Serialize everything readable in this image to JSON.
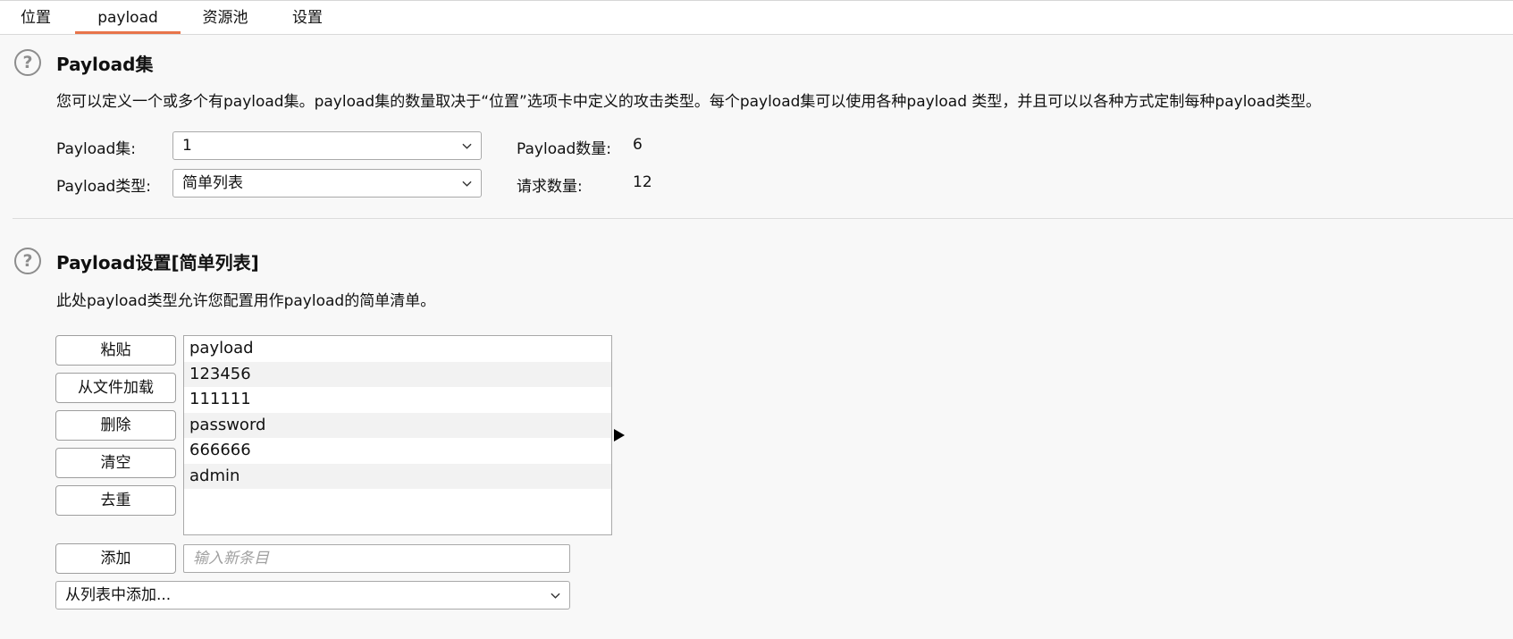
{
  "tabs": [
    {
      "label": "位置",
      "active": false
    },
    {
      "label": "payload",
      "active": true
    },
    {
      "label": "资源池",
      "active": false
    },
    {
      "label": "设置",
      "active": false
    }
  ],
  "payload_sets": {
    "help_icon": "question-circle-icon",
    "title": "Payload集",
    "description": "您可以定义一个或多个有payload集。payload集的数量取决于“位置”选项卡中定义的攻击类型。每个payload集可以使用各种payload 类型，并且可以以各种方式定制每种payload类型。",
    "set_label": "Payload集:",
    "set_value": "1",
    "type_label": "Payload类型:",
    "type_value": "简单列表",
    "count_label": "Payload数量:",
    "count_value": "6",
    "request_label": "请求数量:",
    "request_value": "12"
  },
  "payload_options": {
    "help_icon": "question-circle-icon",
    "title": "Payload设置[简单列表]",
    "description": "此处payload类型允许您配置用作payload的简单清单。",
    "buttons": {
      "paste": "粘贴",
      "load": "从文件加载",
      "remove": "删除",
      "clear": "清空",
      "dedupe": "去重",
      "add": "添加"
    },
    "items": [
      "payload",
      "123456",
      "111111",
      "password",
      "666666",
      "admin"
    ],
    "add_placeholder": "输入新条目",
    "add_from_list": "从列表中添加..."
  },
  "colors": {
    "active_tab_underline": "#e8744a",
    "background": "#f8f8f8"
  }
}
